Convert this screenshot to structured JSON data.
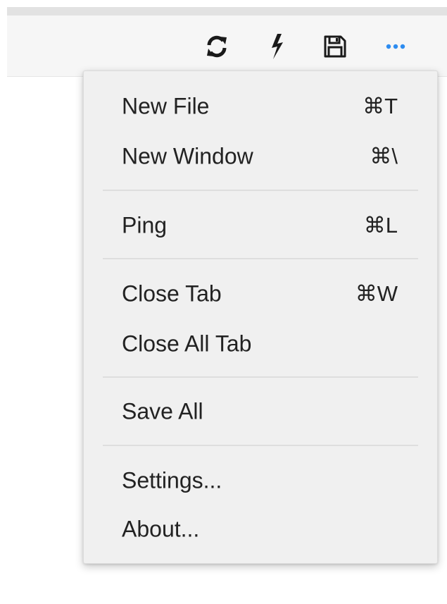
{
  "toolbar": {
    "icons": [
      {
        "name": "refresh-icon",
        "glyph": "refresh"
      },
      {
        "name": "lightning-icon",
        "glyph": "bolt"
      },
      {
        "name": "save-icon",
        "glyph": "floppy"
      },
      {
        "name": "more-icon",
        "glyph": "ellipsis"
      }
    ],
    "icon_color": "#1a1a1a",
    "accent_color": "#2d8cf0"
  },
  "menu": {
    "groups": [
      [
        {
          "label": "New File",
          "shortcut": "⌘T"
        },
        {
          "label": "New Window",
          "shortcut": "⌘\\"
        }
      ],
      [
        {
          "label": "Ping",
          "shortcut": "⌘L"
        }
      ],
      [
        {
          "label": "Close Tab",
          "shortcut": "⌘W"
        },
        {
          "label": "Close All Tab",
          "shortcut": ""
        }
      ],
      [
        {
          "label": "Save All",
          "shortcut": ""
        }
      ],
      [
        {
          "label": "Settings...",
          "shortcut": ""
        },
        {
          "label": "About...",
          "shortcut": ""
        }
      ]
    ]
  }
}
